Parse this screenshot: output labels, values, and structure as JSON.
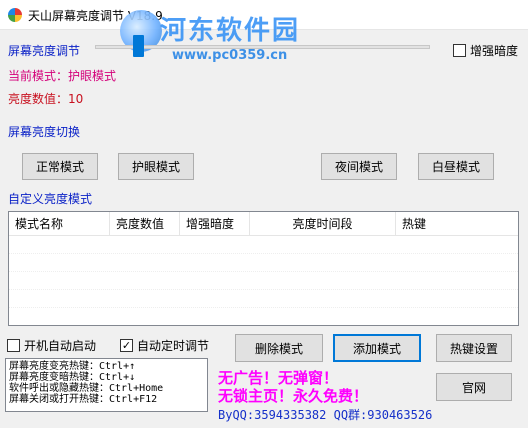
{
  "window": {
    "title": "天山屏幕亮度调节 V18.9"
  },
  "watermark": {
    "line1": "河东软件园",
    "line2": "www.pc0359.cn"
  },
  "slider": {
    "label": "屏幕亮度调节",
    "value_fraction": 0.13
  },
  "enhance_dark": {
    "label": "增强暗度",
    "checked": false
  },
  "current_mode": "当前模式：护眼模式",
  "brightness_value": "亮度数值：10",
  "switch_section": {
    "title": "屏幕亮度切换",
    "buttons": [
      "正常模式",
      "护眼模式",
      "夜间模式",
      "白昼模式"
    ]
  },
  "custom_section": {
    "title": "自定义亮度模式"
  },
  "table": {
    "columns": [
      "模式名称",
      "亮度数值",
      "增强暗度",
      "亮度时间段",
      "热键"
    ],
    "rows": []
  },
  "options": {
    "autostart": {
      "label": "开机自动启动",
      "checked": false
    },
    "auto_timed": {
      "label": "自动定时调节",
      "checked": true
    }
  },
  "actions": {
    "delete": "删除模式",
    "add": "添加模式",
    "hotkey_settings": "热键设置",
    "website": "官网"
  },
  "hotkeys": [
    "屏幕亮度变亮热键：Ctrl+↑",
    "屏幕亮度变暗热键：Ctrl+↓",
    "软件呼出或隐藏热键：Ctrl+Home",
    "屏幕关闭或打开热键：Ctrl+F12"
  ],
  "ad": {
    "line1": "无广告！无弹窗！",
    "line2": "无锁主页！永久免费！",
    "contact": "ByQQ:3594335382 QQ群:930463526"
  },
  "colors": {
    "accent_blue": "#0078d7",
    "mode_magenta": "#d4007a",
    "value_red": "#c8101f",
    "section_blue": "#0b22c7",
    "ad_magenta": "#ff00ff"
  }
}
